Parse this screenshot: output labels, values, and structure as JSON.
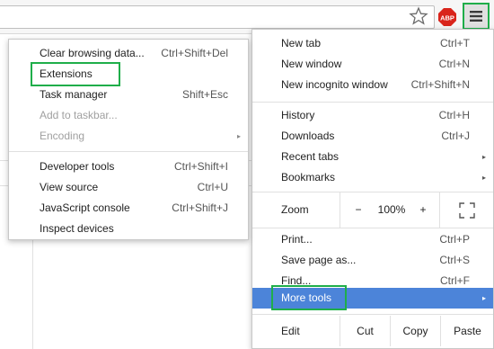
{
  "toolbar": {
    "star_icon": "star-outline-icon",
    "abp_label": "ABP",
    "abp_color": "#d9241b",
    "menu_icon": "hamburger-menu-icon",
    "highlight_color": "#1fae4a"
  },
  "main_menu": {
    "group1": [
      {
        "label": "New tab",
        "shortcut": "Ctrl+T"
      },
      {
        "label": "New window",
        "shortcut": "Ctrl+N"
      },
      {
        "label": "New incognito window",
        "shortcut": "Ctrl+Shift+N"
      }
    ],
    "group2": [
      {
        "label": "History",
        "shortcut": "Ctrl+H"
      },
      {
        "label": "Downloads",
        "shortcut": "Ctrl+J"
      },
      {
        "label": "Recent tabs",
        "arrow": "▸"
      },
      {
        "label": "Bookmarks",
        "arrow": "▸"
      }
    ],
    "zoom": {
      "label": "Zoom",
      "minus": "−",
      "value": "100%",
      "plus": "+",
      "fullscreen_icon": "fullscreen-icon"
    },
    "group3": [
      {
        "label": "Print...",
        "shortcut": "Ctrl+P"
      },
      {
        "label": "Save page as...",
        "shortcut": "Ctrl+S"
      },
      {
        "label": "Find...",
        "shortcut": "Ctrl+F"
      },
      {
        "label": "More tools",
        "arrow": "▸"
      }
    ],
    "edit": {
      "label": "Edit",
      "cut": "Cut",
      "copy": "Copy",
      "paste": "Paste"
    }
  },
  "sub_menu": {
    "group1": [
      {
        "label": "Clear browsing data...",
        "shortcut": "Ctrl+Shift+Del"
      },
      {
        "label": "Extensions",
        "shortcut": ""
      },
      {
        "label": "Task manager",
        "shortcut": "Shift+Esc"
      },
      {
        "label": "Add to taskbar...",
        "shortcut": ""
      },
      {
        "label": "Encoding",
        "arrow": "▸"
      }
    ],
    "group2": [
      {
        "label": "Developer tools",
        "shortcut": "Ctrl+Shift+I"
      },
      {
        "label": "View source",
        "shortcut": "Ctrl+U"
      },
      {
        "label": "JavaScript console",
        "shortcut": "Ctrl+Shift+J"
      },
      {
        "label": "Inspect devices",
        "shortcut": ""
      }
    ]
  }
}
